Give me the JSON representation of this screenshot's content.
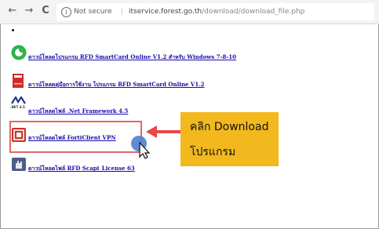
{
  "browser": {
    "back_glyph": "←",
    "forward_glyph": "→",
    "reload_glyph": "C",
    "info_glyph": "i",
    "security_text": "Not secure",
    "separator": "|",
    "url_host": "itservice.forest.go.th",
    "url_path": "/download/download_file.php"
  },
  "page": {
    "links": [
      {
        "icon": "green-circle-app-icon",
        "text": "ดาวน์โหลดโปรแกรม RFD SmartCard Online V1.2 สำหรับ Windows 7-8-10"
      },
      {
        "icon": "red-book-icon",
        "text": "ดาวน์โหลดคู่มือการใช้งาน โปรแกรม RFD SmartCard Online V1.2"
      },
      {
        "icon": "dotnet-icon",
        "icon_text": ".NET 4.5",
        "text": "ดาวน์โหลดไฟล์ .Net Framework 4.5"
      },
      {
        "icon": "forticlient-icon",
        "text": "ดาวน์โหลดไฟล์ FortiClient VPN"
      },
      {
        "icon": "hand-installer-icon",
        "text": "ดาวน์โหลดไฟล์ RFD Scapi_License 63"
      }
    ]
  },
  "annotation": {
    "line1": "คลิก Download",
    "line2": "โปรแกรม",
    "box_color": "#f2b81d",
    "highlight_color": "#e06868",
    "arrow_color": "#e84848"
  }
}
